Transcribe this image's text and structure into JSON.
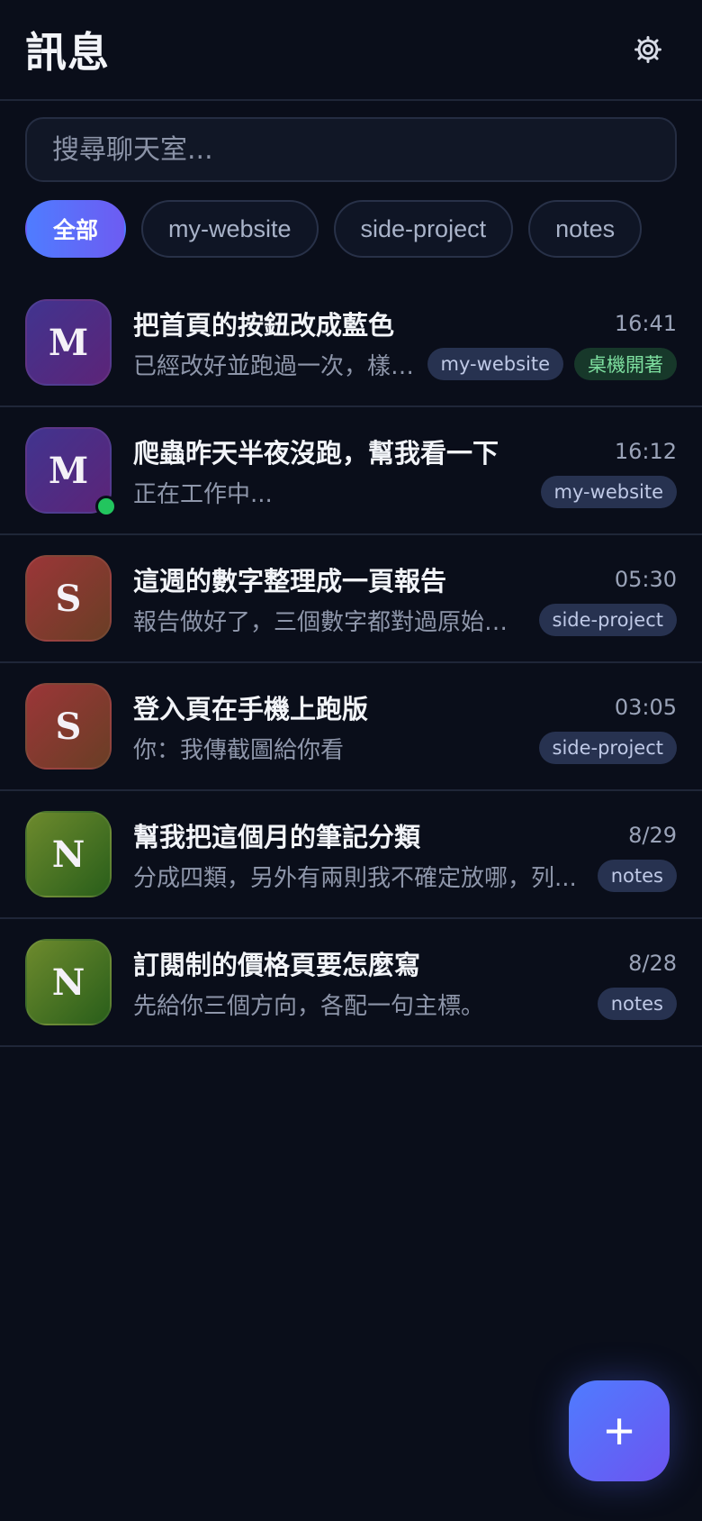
{
  "header": {
    "title": "訊息",
    "settings_icon": "gear-icon"
  },
  "search": {
    "placeholder": "搜尋聊天室..."
  },
  "filters": [
    "全部",
    "my-website",
    "side-project",
    "notes"
  ],
  "chats": [
    {
      "avatar": "M",
      "title": "把首頁的按鈕改成藍色",
      "time": "16:41",
      "preview": "已經改好並跑過一次，樣式...",
      "badge": "my-website",
      "badge_extra": "桌機開著"
    },
    {
      "avatar": "M",
      "title": "爬蟲昨天半夜沒跑，幫我看一下",
      "time": "16:12",
      "preview": "正在工作中...",
      "badge": "my-website",
      "online": true
    },
    {
      "avatar": "S",
      "title": "這週的數字整理成一頁報告",
      "time": "05:30",
      "preview": "報告做好了，三個數字都對過原始檔。",
      "badge": "side-project"
    },
    {
      "avatar": "S",
      "title": "登入頁在手機上跑版",
      "time": "03:05",
      "preview": "你：我傳截圖給你看",
      "badge": "side-project"
    },
    {
      "avatar": "N",
      "title": "幫我把這個月的筆記分類",
      "time": "8/29",
      "preview": "分成四類，另外有兩則我不確定放哪，列...",
      "badge": "notes"
    },
    {
      "avatar": "N",
      "title": "訂閱制的價格頁要怎麼寫",
      "time": "8/28",
      "preview": "先給你三個方向，各配一句主標。",
      "badge": "notes"
    }
  ],
  "fab": {
    "label": "+",
    "icon": "plus-icon"
  },
  "colors": {
    "background": "#0a0e1a",
    "accent": "#4f7cff",
    "online": "#22c55e"
  }
}
